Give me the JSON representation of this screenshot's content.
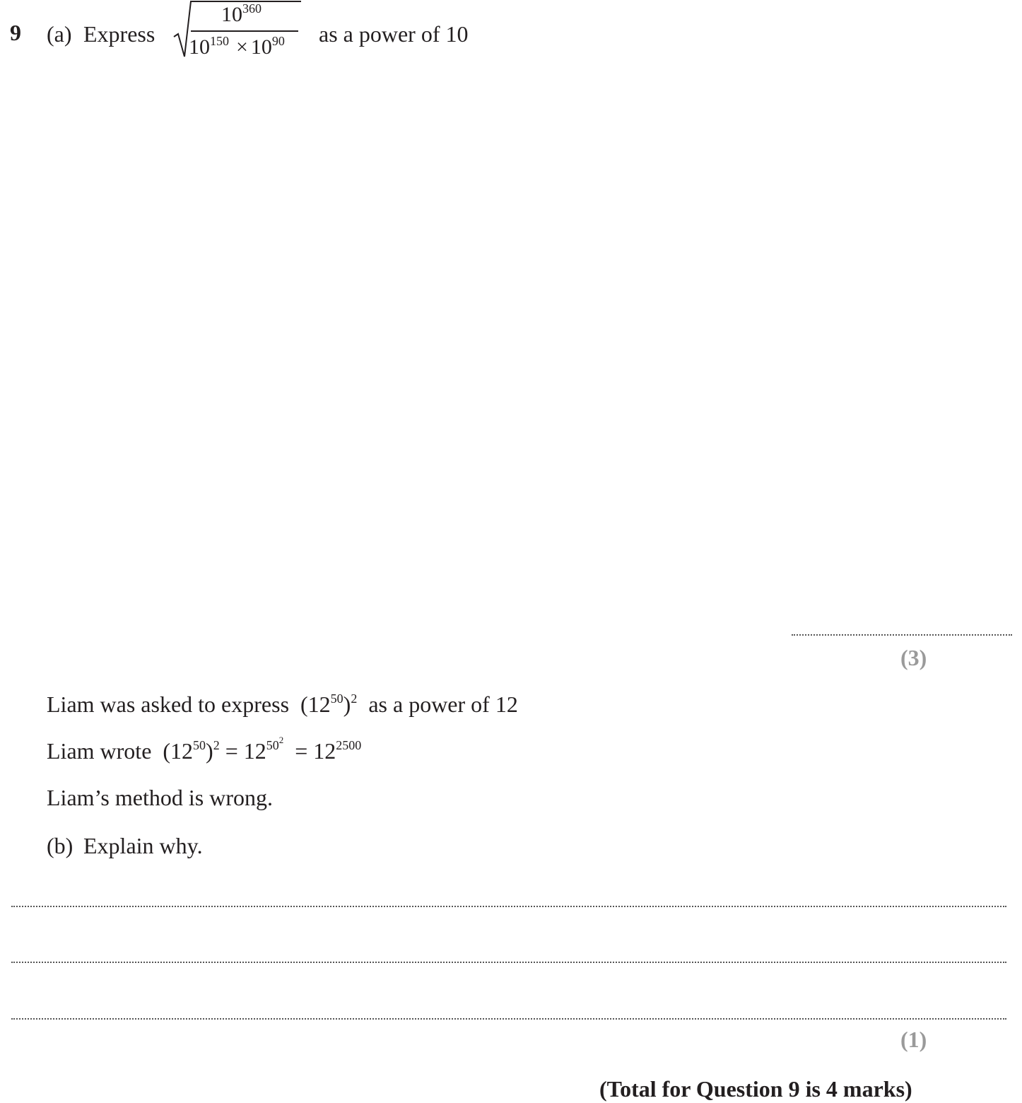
{
  "question": {
    "number": "9",
    "part_a": {
      "label": "(a)",
      "verb": "Express",
      "expression": {
        "numerator_base": "10",
        "numerator_exp": "360",
        "denominator_base1": "10",
        "denominator_exp1": "150",
        "operator": "×",
        "denominator_base2": "10",
        "denominator_exp2": "90"
      },
      "suffix": "as a power of 10",
      "marks": "(3)"
    },
    "stem": {
      "line1_prefix": "Liam was asked to express",
      "line1_expr_open": "(12",
      "line1_expr_exp": "50",
      "line1_expr_close": ")",
      "line1_expr_outer_exp": "2",
      "line1_suffix": "as a power of 12",
      "line2_prefix": "Liam wrote",
      "line2_lhs_open": "(12",
      "line2_lhs_exp": "50",
      "line2_lhs_close": ")",
      "line2_lhs_outer_exp": "2",
      "line2_eq1": "= 12",
      "line2_mid_exp": "50",
      "line2_mid_exp2": "2",
      "line2_eq2": "= 12",
      "line2_rhs_exp": "2500",
      "line3": "Liam’s method is wrong."
    },
    "part_b": {
      "label": "(b)",
      "text": "Explain why.",
      "marks": "(1)"
    },
    "total": "(Total for Question 9 is 4 marks)"
  }
}
